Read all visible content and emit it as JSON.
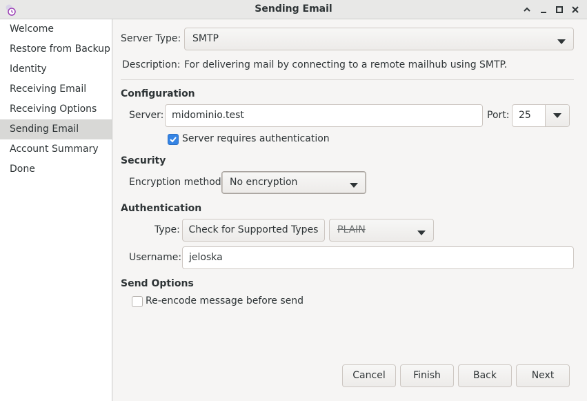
{
  "window": {
    "title": "Sending Email",
    "controls": [
      "chevron-up-icon",
      "minimize-icon",
      "maximize-icon",
      "close-icon"
    ]
  },
  "sidebar": {
    "items": [
      {
        "label": "Welcome",
        "selected": false
      },
      {
        "label": "Restore from Backup",
        "selected": false
      },
      {
        "label": "Identity",
        "selected": false
      },
      {
        "label": "Receiving Email",
        "selected": false
      },
      {
        "label": "Receiving Options",
        "selected": false
      },
      {
        "label": "Sending Email",
        "selected": true
      },
      {
        "label": "Account Summary",
        "selected": false
      },
      {
        "label": "Done",
        "selected": false
      }
    ]
  },
  "form": {
    "server_type_label": "Server Type:",
    "server_type_value": "SMTP",
    "description_label": "Description:",
    "description_value": "For delivering mail by connecting to a remote mailhub using SMTP.",
    "configuration": {
      "heading": "Configuration",
      "server_label": "Server:",
      "server_value": "midominio.test",
      "port_label": "Port:",
      "port_value": "25",
      "auth_required_label": "Server requires authentication",
      "auth_required_checked": true
    },
    "security": {
      "heading": "Security",
      "encryption_label": "Encryption method:",
      "encryption_value": "No encryption"
    },
    "authentication": {
      "heading": "Authentication",
      "type_label": "Type:",
      "check_types_button": "Check for Supported Types",
      "type_value": "PLAIN",
      "username_label": "Username:",
      "username_value": "jeloska"
    },
    "send_options": {
      "heading": "Send Options",
      "reencode_label": "Re-encode message before send",
      "reencode_checked": false
    }
  },
  "buttons": {
    "cancel": "Cancel",
    "finish": "Finish",
    "back": "Back",
    "next": "Next"
  },
  "colors": {
    "accent": "#3584e4",
    "selected_row": "#d8d8d6",
    "window_bg": "#f6f5f4"
  }
}
